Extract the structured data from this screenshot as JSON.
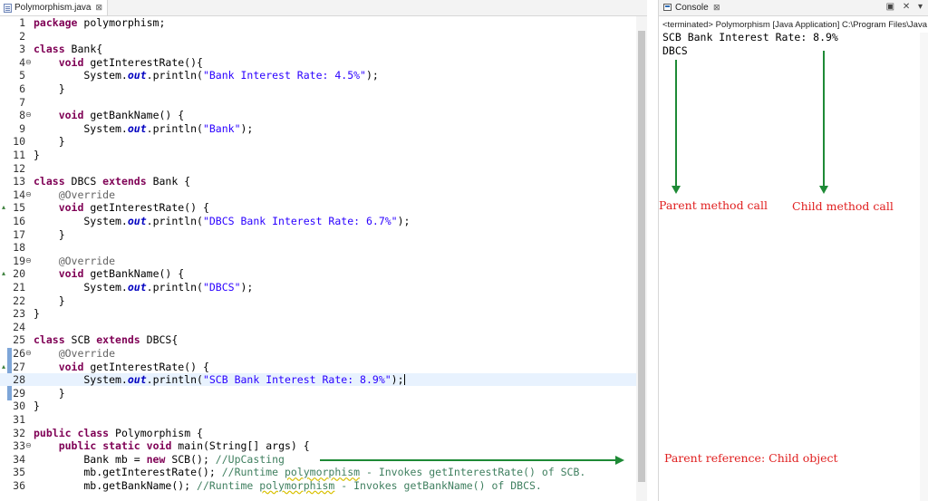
{
  "editor": {
    "tab_title": "Polymorphism.java",
    "tab_close": "⊠",
    "lines": [
      {
        "n": "1",
        "tokens": [
          {
            "t": "package",
            "c": "kw"
          },
          {
            "t": " polymorphism;"
          }
        ]
      },
      {
        "n": "2",
        "tokens": []
      },
      {
        "n": "3",
        "tokens": [
          {
            "t": "class",
            "c": "kw"
          },
          {
            "t": " Bank{"
          }
        ]
      },
      {
        "n": "4",
        "m": "⊖",
        "tokens": [
          {
            "t": "    "
          },
          {
            "t": "void",
            "c": "kw"
          },
          {
            "t": " getInterestRate(){"
          }
        ]
      },
      {
        "n": "5",
        "tokens": [
          {
            "t": "        System."
          },
          {
            "t": "out",
            "c": "fld"
          },
          {
            "t": ".println("
          },
          {
            "t": "\"Bank Interest Rate: 4.5%\"",
            "c": "str"
          },
          {
            "t": ");"
          }
        ]
      },
      {
        "n": "6",
        "tokens": [
          {
            "t": "    }"
          }
        ]
      },
      {
        "n": "7",
        "tokens": []
      },
      {
        "n": "8",
        "m": "⊖",
        "tokens": [
          {
            "t": "    "
          },
          {
            "t": "void",
            "c": "kw"
          },
          {
            "t": " getBankName() {"
          }
        ]
      },
      {
        "n": "9",
        "tokens": [
          {
            "t": "        System."
          },
          {
            "t": "out",
            "c": "fld"
          },
          {
            "t": ".println("
          },
          {
            "t": "\"Bank\"",
            "c": "str"
          },
          {
            "t": ");"
          }
        ]
      },
      {
        "n": "10",
        "tokens": [
          {
            "t": "    }"
          }
        ]
      },
      {
        "n": "11",
        "tokens": [
          {
            "t": "}"
          }
        ]
      },
      {
        "n": "12",
        "tokens": []
      },
      {
        "n": "13",
        "tokens": [
          {
            "t": "class",
            "c": "kw"
          },
          {
            "t": " DBCS "
          },
          {
            "t": "extends",
            "c": "kw"
          },
          {
            "t": " Bank {"
          }
        ]
      },
      {
        "n": "14",
        "m": "⊖",
        "tokens": [
          {
            "t": "    "
          },
          {
            "t": "@Override",
            "c": "ann"
          }
        ]
      },
      {
        "n": "15",
        "ov": "▴",
        "tokens": [
          {
            "t": "    "
          },
          {
            "t": "void",
            "c": "kw"
          },
          {
            "t": " getInterestRate() {"
          }
        ]
      },
      {
        "n": "16",
        "tokens": [
          {
            "t": "        System."
          },
          {
            "t": "out",
            "c": "fld"
          },
          {
            "t": ".println("
          },
          {
            "t": "\"DBCS Bank Interest Rate: 6.7%\"",
            "c": "str"
          },
          {
            "t": ");"
          }
        ]
      },
      {
        "n": "17",
        "tokens": [
          {
            "t": "    }"
          }
        ]
      },
      {
        "n": "18",
        "tokens": []
      },
      {
        "n": "19",
        "m": "⊖",
        "tokens": [
          {
            "t": "    "
          },
          {
            "t": "@Override",
            "c": "ann"
          }
        ]
      },
      {
        "n": "20",
        "ov": "▴",
        "tokens": [
          {
            "t": "    "
          },
          {
            "t": "void",
            "c": "kw"
          },
          {
            "t": " getBankName() {"
          }
        ]
      },
      {
        "n": "21",
        "tokens": [
          {
            "t": "        System."
          },
          {
            "t": "out",
            "c": "fld"
          },
          {
            "t": ".println("
          },
          {
            "t": "\"DBCS\"",
            "c": "str"
          },
          {
            "t": ");"
          }
        ]
      },
      {
        "n": "22",
        "tokens": [
          {
            "t": "    }"
          }
        ]
      },
      {
        "n": "23",
        "tokens": [
          {
            "t": "}"
          }
        ]
      },
      {
        "n": "24",
        "tokens": []
      },
      {
        "n": "25",
        "tokens": [
          {
            "t": "class",
            "c": "kw"
          },
          {
            "t": " SCB "
          },
          {
            "t": "extends",
            "c": "kw"
          },
          {
            "t": " DBCS{"
          }
        ]
      },
      {
        "n": "26",
        "m": "⊖",
        "tokens": [
          {
            "t": "    "
          },
          {
            "t": "@Override",
            "c": "ann"
          }
        ]
      },
      {
        "n": "27",
        "ov": "▴",
        "tokens": [
          {
            "t": "    "
          },
          {
            "t": "void",
            "c": "kw"
          },
          {
            "t": " getInterestRate() {"
          }
        ]
      },
      {
        "n": "28",
        "current": true,
        "tokens": [
          {
            "t": "        System."
          },
          {
            "t": "out",
            "c": "fld"
          },
          {
            "t": ".println("
          },
          {
            "t": "\"SCB Bank Interest Rate: 8.9%\"",
            "c": "str"
          },
          {
            "t": ");"
          }
        ]
      },
      {
        "n": "29",
        "tokens": [
          {
            "t": "    }"
          }
        ]
      },
      {
        "n": "30",
        "tokens": [
          {
            "t": "}"
          }
        ]
      },
      {
        "n": "31",
        "tokens": []
      },
      {
        "n": "32",
        "tokens": [
          {
            "t": "public",
            "c": "kw"
          },
          {
            "t": " "
          },
          {
            "t": "class",
            "c": "kw"
          },
          {
            "t": " Polymorphism {"
          }
        ]
      },
      {
        "n": "33",
        "m": "⊖",
        "tokens": [
          {
            "t": "    "
          },
          {
            "t": "public",
            "c": "kw"
          },
          {
            "t": " "
          },
          {
            "t": "static",
            "c": "kw"
          },
          {
            "t": " "
          },
          {
            "t": "void",
            "c": "kw"
          },
          {
            "t": " main(String[] args) {"
          }
        ]
      },
      {
        "n": "34",
        "tokens": [
          {
            "t": "        Bank mb = "
          },
          {
            "t": "new",
            "c": "kw"
          },
          {
            "t": " SCB(); "
          },
          {
            "t": "//UpCasting",
            "c": "cm"
          }
        ]
      },
      {
        "n": "35",
        "tokens": [
          {
            "t": "        mb.getInterestRate(); "
          },
          {
            "t": "//Runtime ",
            "c": "cm"
          },
          {
            "t": "polymorphism",
            "c": "cm sq"
          },
          {
            "t": " - Invokes getInterestRate() of SCB.",
            "c": "cm"
          }
        ]
      },
      {
        "n": "36",
        "tokens": [
          {
            "t": "        mb.getBankName(); "
          },
          {
            "t": "//Runtime ",
            "c": "cm"
          },
          {
            "t": "polymorphism",
            "c": "cm sq"
          },
          {
            "t": " - Invokes getBankName() of DBCS.",
            "c": "cm"
          }
        ]
      }
    ]
  },
  "console": {
    "tab_title": "Console",
    "tab_close": "⊠",
    "toolbar": "▣ ✕ ▾",
    "terminated": "<terminated> Polymorphism [Java Application] C:\\Program Files\\Java",
    "output": [
      "SCB Bank Interest Rate: 8.9%",
      "DBCS"
    ]
  },
  "annotations": {
    "parent_method_call": "Parent method call",
    "child_method_call": "Child method call",
    "parent_reference": "Parent reference: Child object",
    "arrow_color": "#1e8a36",
    "text_color": "#e02020"
  }
}
